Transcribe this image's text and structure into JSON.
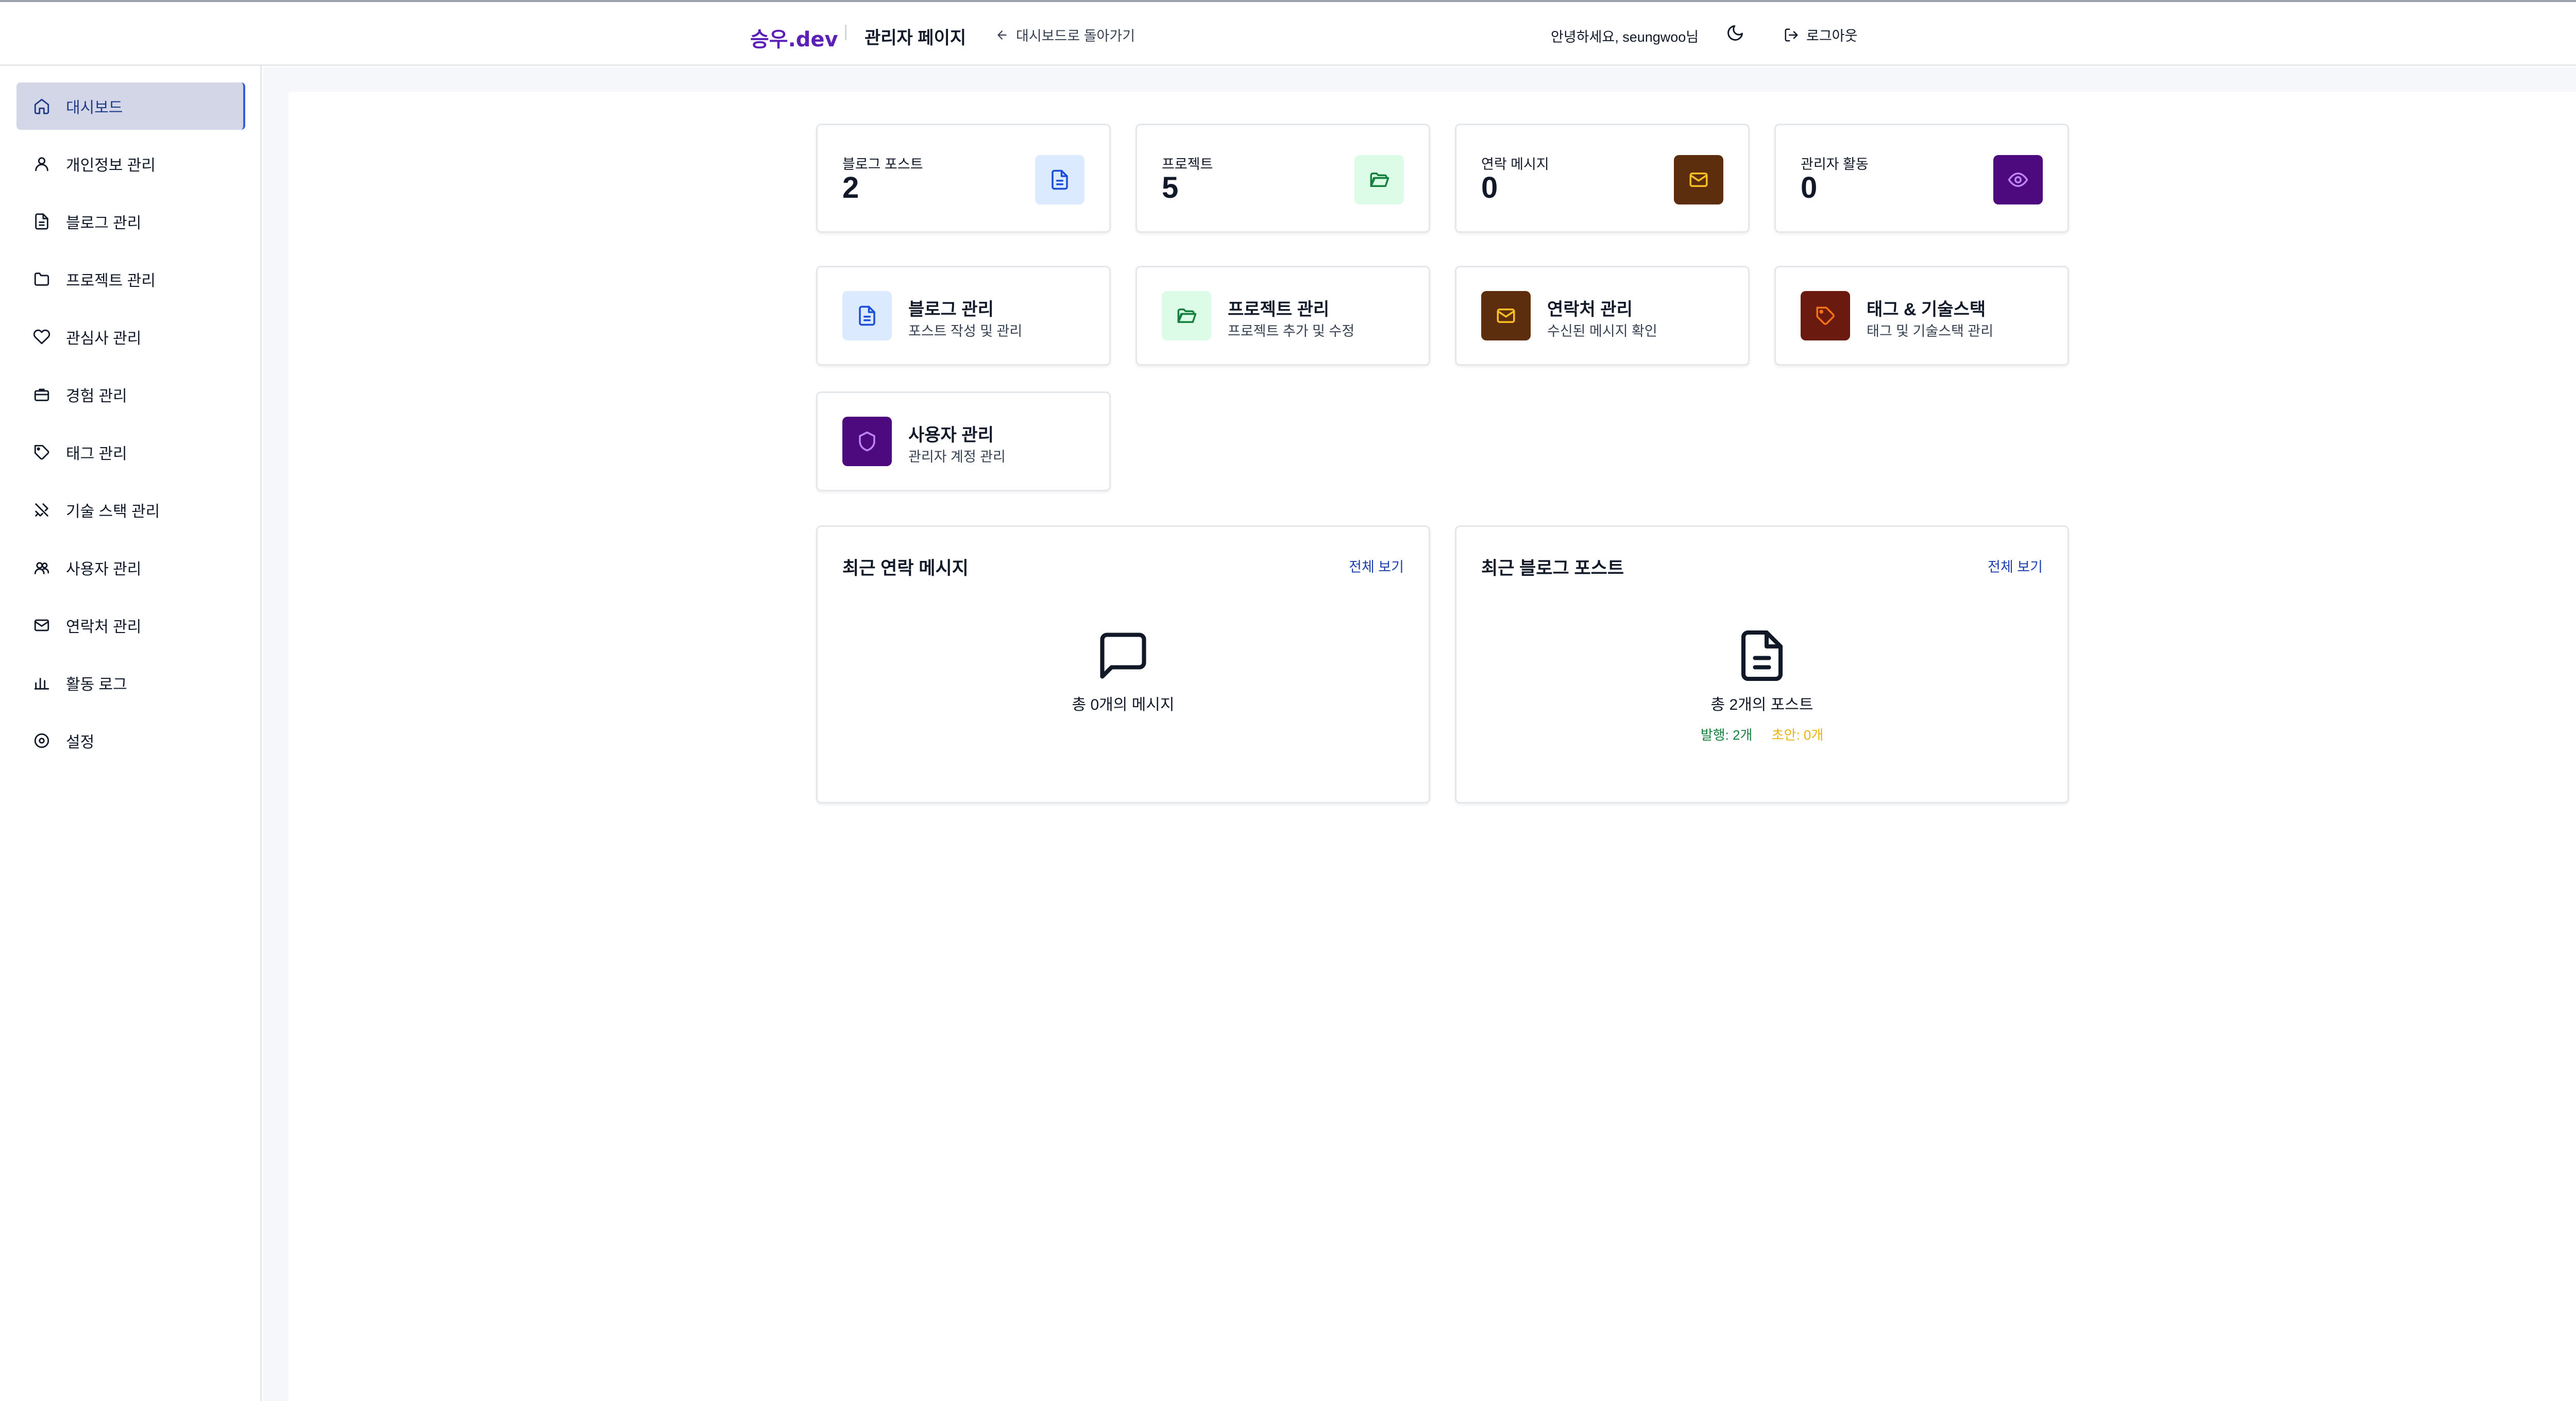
{
  "header": {
    "brand": "승우.dev",
    "admin_title": "관리자 페이지",
    "back_link": "대시보드로 돌아가기",
    "greeting": "안녕하세요, seungwoo님",
    "logout": "로그아웃"
  },
  "sidebar": {
    "items": [
      {
        "label": "대시보드",
        "icon": "home-icon",
        "active": true
      },
      {
        "label": "개인정보 관리",
        "icon": "user-icon"
      },
      {
        "label": "블로그 관리",
        "icon": "file-text-icon"
      },
      {
        "label": "프로젝트 관리",
        "icon": "folder-icon"
      },
      {
        "label": "관심사 관리",
        "icon": "heart-icon"
      },
      {
        "label": "경험 관리",
        "icon": "briefcase-icon"
      },
      {
        "label": "태그 관리",
        "icon": "tag-icon"
      },
      {
        "label": "기술 스택 관리",
        "icon": "tools-icon"
      },
      {
        "label": "사용자 관리",
        "icon": "users-icon"
      },
      {
        "label": "연락처 관리",
        "icon": "mail-icon"
      },
      {
        "label": "활동 로그",
        "icon": "bar-chart-icon"
      },
      {
        "label": "설정",
        "icon": "settings-icon"
      }
    ]
  },
  "stats": [
    {
      "label": "블로그 포스트",
      "value": "2",
      "icon": "file-text-icon",
      "bg": "#dbeafe",
      "fg": "#1d4ed8"
    },
    {
      "label": "프로젝트",
      "value": "5",
      "icon": "folder-open-icon",
      "bg": "#dcfce7",
      "fg": "#15803d"
    },
    {
      "label": "연락 메시지",
      "value": "0",
      "icon": "mail-icon",
      "bg": "#5c2e0e",
      "fg": "#fbbf24"
    },
    {
      "label": "관리자 활동",
      "value": "0",
      "icon": "eye-icon",
      "bg": "#4c0a7e",
      "fg": "#c084fc"
    }
  ],
  "quick_actions": [
    {
      "title": "블로그 관리",
      "subtitle": "포스트 작성 및 관리",
      "icon": "file-text-icon",
      "bg": "#dbeafe",
      "fg": "#1d4ed8"
    },
    {
      "title": "프로젝트 관리",
      "subtitle": "프로젝트 추가 및 수정",
      "icon": "folder-open-icon",
      "bg": "#dcfce7",
      "fg": "#15803d"
    },
    {
      "title": "연락처 관리",
      "subtitle": "수신된 메시지 확인",
      "icon": "mail-icon",
      "bg": "#5c2e0e",
      "fg": "#fbbf24"
    },
    {
      "title": "태그 & 기술스택",
      "subtitle": "태그 및 기술스택 관리",
      "icon": "tag-icon",
      "bg": "#6b1a10",
      "fg": "#f97316"
    },
    {
      "title": "사용자 관리",
      "subtitle": "관리자 계정 관리",
      "icon": "shield-icon",
      "bg": "#4c0a7e",
      "fg": "#c084fc"
    }
  ],
  "recent_messages": {
    "title": "최근 연락 메시지",
    "link": "전체 보기",
    "empty_text": "총 0개의 메시지"
  },
  "recent_posts": {
    "title": "최근 블로그 포스트",
    "link": "전체 보기",
    "summary": "총 2개의 포스트",
    "published": "발행: 2개",
    "draft": "초안: 0개"
  }
}
